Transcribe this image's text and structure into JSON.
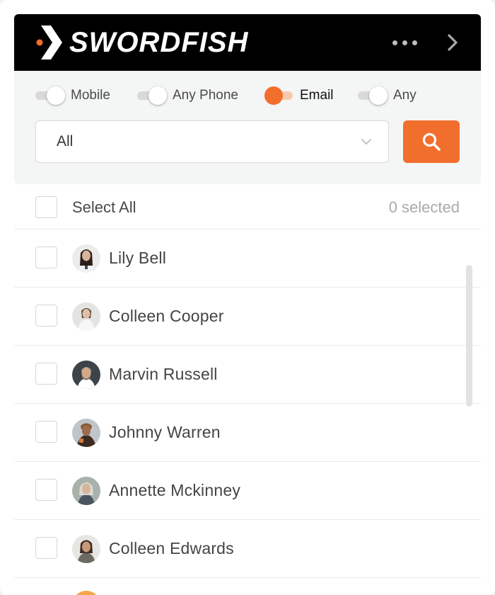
{
  "header": {
    "brand": "SWORDFISH",
    "logo_icon": "swordfish-logo-icon",
    "more_icon": "more-dots-icon",
    "next_icon": "chevron-right-icon"
  },
  "filters": {
    "toggles": [
      {
        "label": "Mobile",
        "on": false
      },
      {
        "label": "Any Phone",
        "on": false
      },
      {
        "label": "Email",
        "on": true
      },
      {
        "label": "Any",
        "on": false
      }
    ],
    "dropdown": {
      "selected": "All"
    },
    "search_icon": "search-icon"
  },
  "list": {
    "select_all_label": "Select All",
    "selected_count": "0 selected",
    "contacts": [
      {
        "name": "Lily Bell"
      },
      {
        "name": "Colleen Cooper"
      },
      {
        "name": "Marvin Russell"
      },
      {
        "name": "Johnny Warren"
      },
      {
        "name": "Annette Mckinney"
      },
      {
        "name": "Colleen Edwards"
      }
    ]
  },
  "colors": {
    "accent": "#f26e2c",
    "header_bg": "#000000",
    "filter_bg": "#f4f5f5"
  }
}
